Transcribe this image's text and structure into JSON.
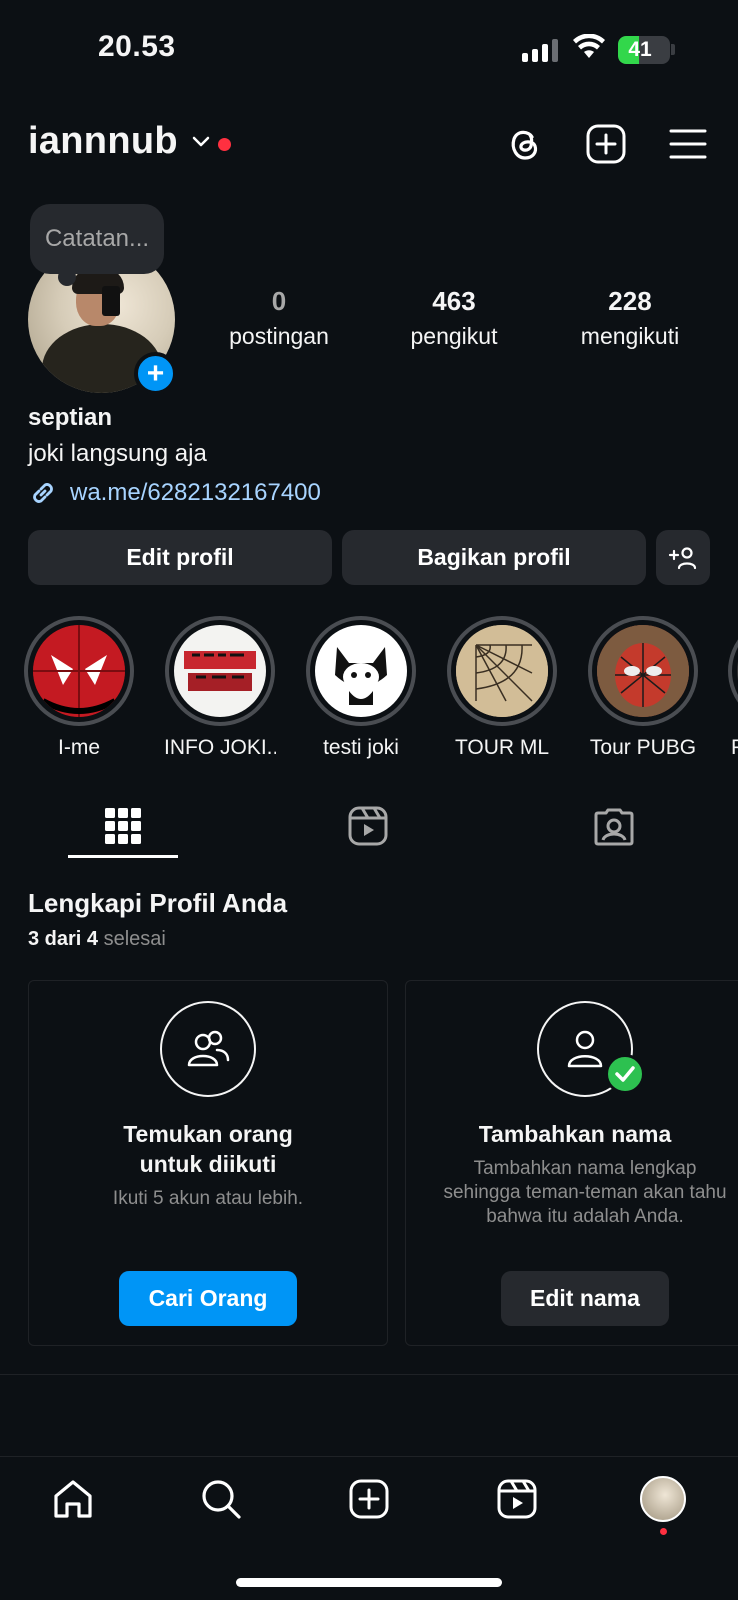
{
  "status_bar": {
    "time": "20.53",
    "battery": "41",
    "battery_level": 0.41
  },
  "header": {
    "username": "iannnub"
  },
  "note": {
    "placeholder": "Catatan..."
  },
  "stats": [
    {
      "value": "0",
      "label": "postingan"
    },
    {
      "value": "463",
      "label": "pengikut"
    },
    {
      "value": "228",
      "label": "mengikuti"
    }
  ],
  "profile": {
    "name": "septian",
    "bio": "joki langsung aja",
    "link": "wa.me/6282132167400"
  },
  "buttons": {
    "edit": "Edit profil",
    "share": "Bagikan profil"
  },
  "highlights": [
    {
      "label": "I-me"
    },
    {
      "label": "INFO JOKI..."
    },
    {
      "label": "testi joki"
    },
    {
      "label": "TOUR ML"
    },
    {
      "label": "Tour PUBG"
    },
    {
      "label": "P"
    }
  ],
  "complete_profile": {
    "title": "Lengkapi Profil Anda",
    "progress_done": "3 dari 4",
    "progress_suffix": "selesai",
    "cards": [
      {
        "title": "Temukan orang untuk diikuti",
        "desc": "Ikuti 5 akun atau lebih.",
        "button": "Cari Orang"
      },
      {
        "title": "Tambahkan nama",
        "desc": "Tambahkan nama lengkap sehingga teman-teman akan tahu bahwa itu adalah Anda.",
        "button": "Edit nama"
      }
    ]
  },
  "colors": {
    "background": "#0c1014",
    "accent": "#0095f6",
    "notification": "#ff3040",
    "success": "#2dc150"
  },
  "icons": [
    "threads-icon",
    "create-icon",
    "menu-icon",
    "link-icon",
    "add-person-icon",
    "grid-icon",
    "reels-icon",
    "tagged-icon",
    "home-icon",
    "search-icon",
    "create-post-icon",
    "reels-nav-icon"
  ]
}
